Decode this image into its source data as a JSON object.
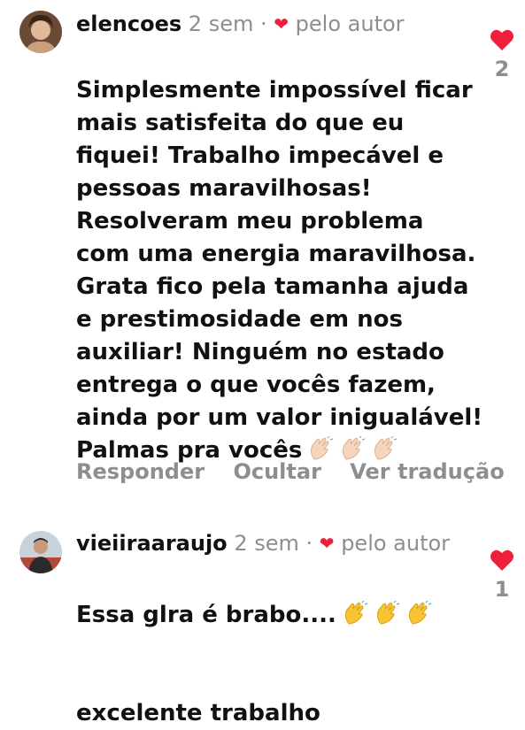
{
  "comments": [
    {
      "username": "elencoes",
      "time": "2 sem",
      "separator": "·",
      "liked_by_author_label": "pelo autor",
      "text": "Simplesmente impossível ficar\nmais satisfeita do que eu\nfiquei! Trabalho impecável e\npessoas maravilhosas!\nResolveram meu problema\ncom uma energia maravilhosa.\nGrata fico pela tamanha ajuda\ne prestimosidade em nos\nauxiliar! Ninguém no estado\nentrega o que vocês fazem,\nainda por um valor inigualável!\nPalmas pra vocês",
      "emoji_icons": [
        "clapping-hands-icon",
        "clapping-hands-icon",
        "clapping-hands-icon"
      ],
      "like_count": "2",
      "actions": {
        "reply": "Responder",
        "hide": "Ocultar",
        "translate": "Ver tradução"
      }
    },
    {
      "username": "vieiiraaraujo",
      "time": "2 sem",
      "separator": "·",
      "liked_by_author_label": "pelo autor",
      "text": "Essa glra é brabo....",
      "text_line2": "excelente trabalho",
      "emoji_icons": [
        "clapping-hands-icon",
        "clapping-hands-icon",
        "clapping-hands-icon"
      ],
      "like_count": "1"
    }
  ],
  "colors": {
    "heart": "#ed1f3a",
    "muted": "#8e8e8e",
    "text": "#111111"
  }
}
